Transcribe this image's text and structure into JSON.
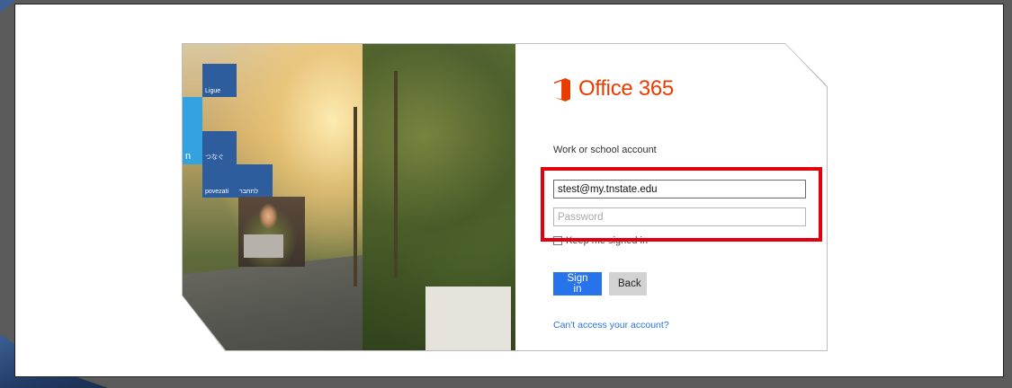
{
  "brand": {
    "name": "Office 365",
    "color": "#eb3c00"
  },
  "tiles": [
    {
      "label": "Ligue",
      "color": "#2e5d9e"
    },
    {
      "label": "",
      "color": "#33a2e0"
    },
    {
      "label": "つなぐ",
      "color": "#2e5d9e"
    },
    {
      "label": "n",
      "color": "#33a2e0"
    },
    {
      "label": "povezati",
      "color": "#2e5d9e"
    },
    {
      "label": "לתחבר",
      "color": "#2e5d9e"
    },
    {
      "label": "",
      "color": "#2e5d9e"
    }
  ],
  "form": {
    "account_label": "Work or school account",
    "email_value": "stest@my.tnstate.edu",
    "password_placeholder": "Password",
    "keep_signed_in_label": "Keep me signed in",
    "signin_label": "Sign in",
    "back_label": "Back",
    "cant_access_link": "Can't access your account?"
  },
  "colors": {
    "accent": "#2673ec",
    "highlight": "#e2000f"
  }
}
